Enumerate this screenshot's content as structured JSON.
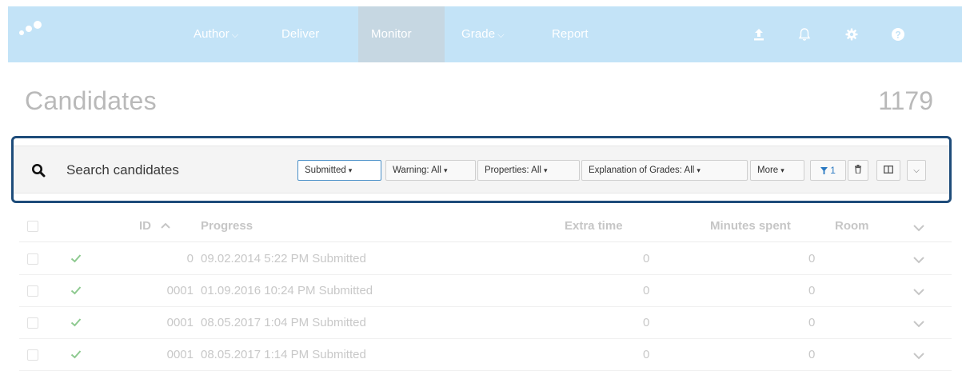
{
  "nav": {
    "items": [
      {
        "label": "Author",
        "has_dropdown": true,
        "active": false
      },
      {
        "label": "Deliver",
        "has_dropdown": false,
        "active": false
      },
      {
        "label": "Monitor",
        "has_dropdown": false,
        "active": true
      },
      {
        "label": "Grade",
        "has_dropdown": true,
        "active": false
      },
      {
        "label": "Report",
        "has_dropdown": false,
        "active": false
      }
    ],
    "icons": [
      "upload-icon",
      "bell-icon",
      "gear-icon",
      "help-icon"
    ]
  },
  "page": {
    "title": "Candidates",
    "count": "1179"
  },
  "filters": {
    "search_placeholder": "Search candidates",
    "buttons": [
      {
        "label": "Submitted",
        "selected": true
      },
      {
        "label": "Warning: All",
        "selected": false
      },
      {
        "label": "Properties: All",
        "selected": false
      },
      {
        "label": "Explanation of Grades: All",
        "selected": false
      },
      {
        "label": "More",
        "selected": false
      }
    ],
    "active_filter_count": "1"
  },
  "table": {
    "headers": {
      "id": "ID",
      "progress": "Progress",
      "extra_time": "Extra time",
      "minutes_spent": "Minutes spent",
      "room": "Room"
    },
    "rows": [
      {
        "id": "0",
        "progress": "09.02.2014 5:22 PM Submitted",
        "extra_time": "0",
        "minutes_spent": "0",
        "room": ""
      },
      {
        "id": "0001",
        "progress": "01.09.2016 10:24 PM Submitted",
        "extra_time": "0",
        "minutes_spent": "0",
        "room": ""
      },
      {
        "id": "0001",
        "progress": "08.05.2017 1:04 PM Submitted",
        "extra_time": "0",
        "minutes_spent": "0",
        "room": ""
      },
      {
        "id": "0001",
        "progress": "08.05.2017 1:14 PM Submitted",
        "extra_time": "0",
        "minutes_spent": "0",
        "room": ""
      }
    ]
  },
  "colors": {
    "nav_bg": "#c3e3f7",
    "nav_active_bg": "#c6d7e2",
    "highlight_border": "#1e4c7a",
    "check_green": "#8dc98f",
    "filter_blue": "#2a79c2"
  }
}
